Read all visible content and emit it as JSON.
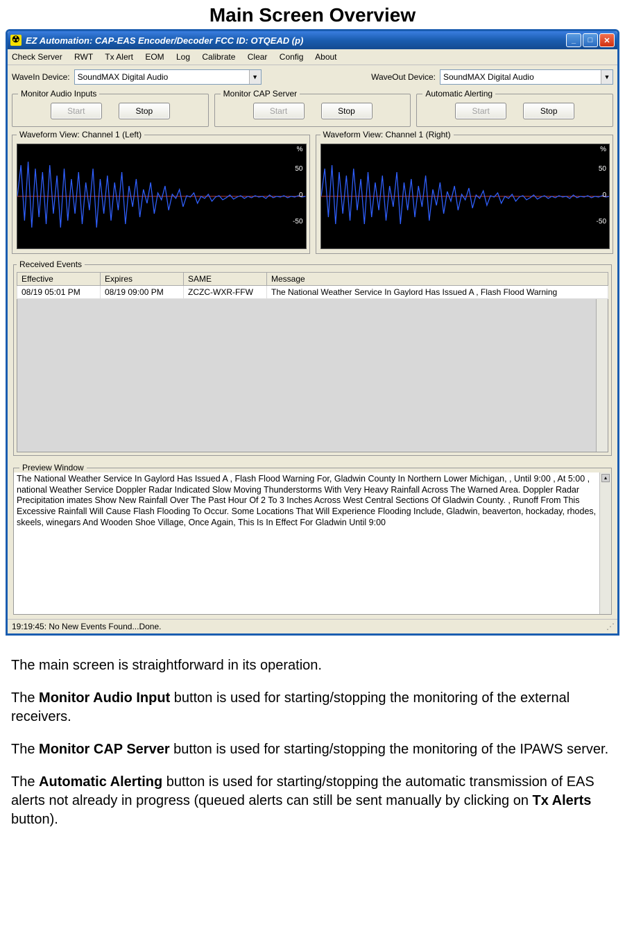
{
  "page_heading": "Main Screen Overview",
  "window_title": "EZ Automation:  CAP-EAS Encoder/Decoder  FCC ID: OTQEAD (p)",
  "menu": [
    "Check Server",
    "RWT",
    "Tx Alert",
    "EOM",
    "Log",
    "Calibrate",
    "Clear",
    "Config",
    "About"
  ],
  "wavein_label": "WaveIn Device:",
  "wavein_value": "SoundMAX Digital Audio",
  "waveout_label": "WaveOut Device:",
  "waveout_value": "SoundMAX Digital Audio",
  "groups": {
    "audio": {
      "legend": "Monitor Audio Inputs",
      "start": "Start",
      "stop": "Stop"
    },
    "cap": {
      "legend": "Monitor CAP Server",
      "start": "Start",
      "stop": "Stop"
    },
    "auto": {
      "legend": "Automatic Alerting",
      "start": "Start",
      "stop": "Stop"
    }
  },
  "wave_left_legend": "Waveform View: Channel 1 (Left)",
  "wave_right_legend": "Waveform View: Channel 1 (Right)",
  "wave_ticks": {
    "pct": "%",
    "p50": "50",
    "zero": "0",
    "m50": "-50"
  },
  "events_legend": "Received Events",
  "events_columns": [
    "Effective",
    "Expires",
    "SAME",
    "Message"
  ],
  "events_row": {
    "effective": "08/19 05:01 PM",
    "expires": "08/19 09:00 PM",
    "same": "ZCZC-WXR-FFW",
    "message": "The National Weather Service In Gaylord Has Issued A , Flash Flood Warning"
  },
  "preview_legend": "Preview Window",
  "preview_text": "The National Weather Service In Gaylord Has Issued A , Flash Flood Warning For,  Gladwin County In Northern Lower Michigan, ,  Until 9:00  , At 5:00 , national Weather Service Doppler Radar Indicated  Slow Moving Thunderstorms With Very Heavy Rainfall Across The   Warned Area. Doppler Radar Precipitation imates Show New  Rainfall Over The Past Hour Of 2 To 3 Inches Across West Central  Sections Of Gladwin County. , Runoff From This Excessive Rainfall Will Cause Flash Flooding To  Occur. Some Locations That Will Experience Flooding Include,  Gladwin, beaverton, hockaday, rhodes, skeels, winegars And  Wooden Shoe Village,  Once Again, This Is In Effect For Gladwin Until 9:00",
  "status": "19:19:45: No New Events Found...Done.",
  "doc": {
    "p1": "The main screen is straightforward in its operation.",
    "p2a": "The ",
    "p2b": "Monitor Audio Input",
    "p2c": " button is used for starting/stopping the monitoring of the external receivers.",
    "p3a": "The ",
    "p3b": "Monitor CAP Server",
    "p3c": " button is used for starting/stopping the monitoring of the IPAWS server.",
    "p4a": "The ",
    "p4b": "Automatic Alerting",
    "p4c": " button is used for starting/stopping the automatic transmission of EAS alerts not already in progress (queued alerts can still be sent manually by clicking on ",
    "p4d": "Tx Alerts",
    "p4e": " button)."
  }
}
